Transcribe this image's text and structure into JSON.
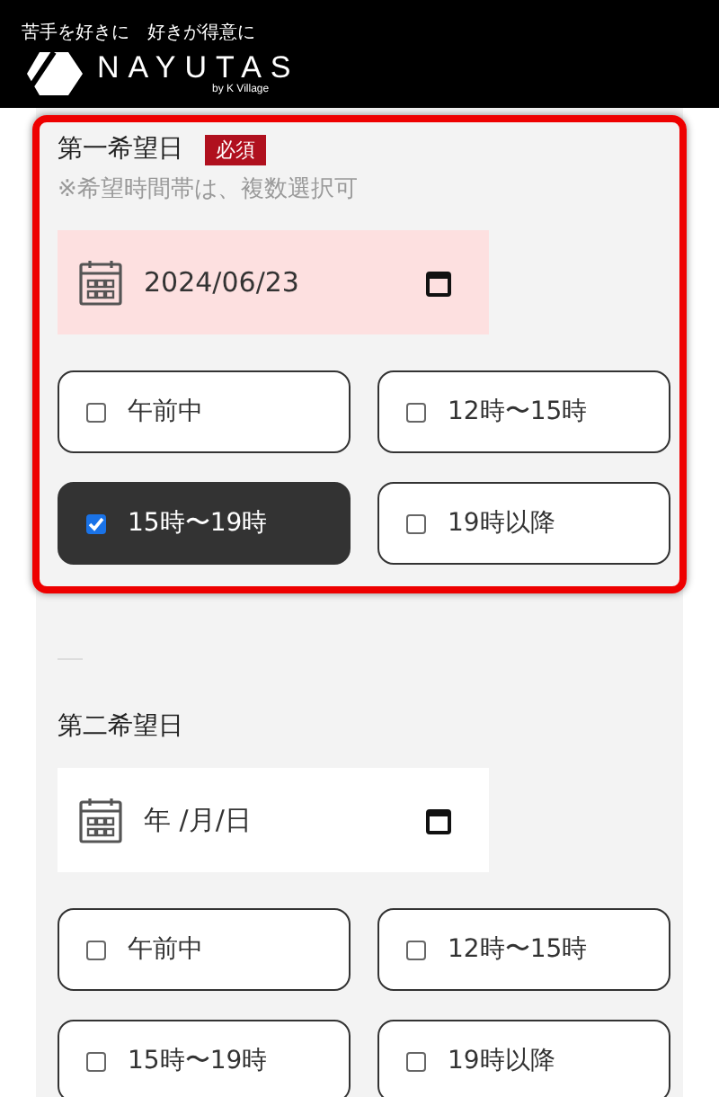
{
  "header": {
    "tagline": "苦手を好きに　好きが得意に",
    "logo_text": "NAYUTAS",
    "logo_sub": "by K Village"
  },
  "sections": [
    {
      "title": "第一希望日",
      "required_badge": "必須",
      "note": "※希望時間帯は、複数選択可",
      "highlighted": true,
      "date": {
        "value": "2024/06/23",
        "filled": true
      },
      "options": [
        {
          "label": "午前中",
          "checked": false
        },
        {
          "label": "12時〜15時",
          "checked": false
        },
        {
          "label": "15時〜19時",
          "checked": true
        },
        {
          "label": "19時以降",
          "checked": false
        }
      ]
    },
    {
      "title": "第二希望日",
      "highlighted": false,
      "date": {
        "placeholder": "年 /月/日",
        "filled": false
      },
      "options": [
        {
          "label": "午前中",
          "checked": false
        },
        {
          "label": "12時〜15時",
          "checked": false
        },
        {
          "label": "15時〜19時",
          "checked": false
        },
        {
          "label": "19時以降",
          "checked": false
        }
      ]
    }
  ]
}
